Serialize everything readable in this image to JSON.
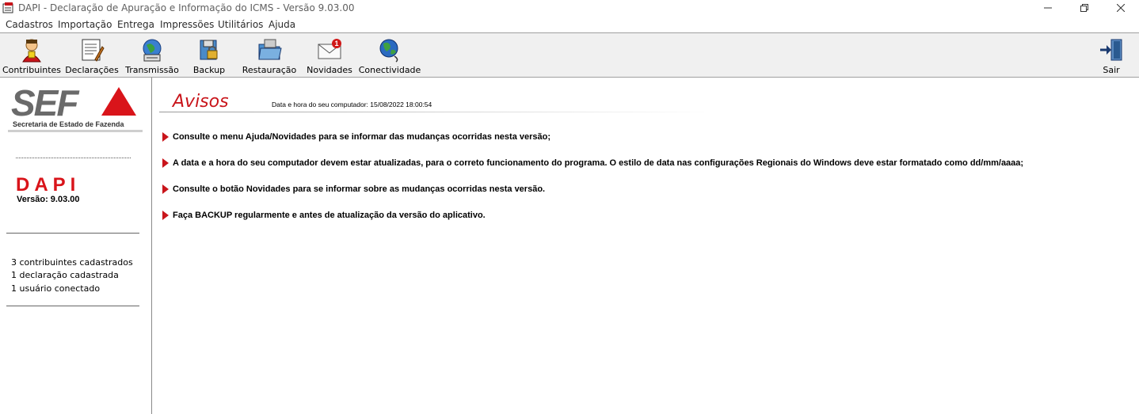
{
  "window": {
    "title": "DAPI - Declaração de Apuração e Informação do ICMS - Versão 9.03.00",
    "minimize": "—",
    "maximize": "❐",
    "close": "✕"
  },
  "menu": [
    "Cadastros",
    "Importação",
    "Entrega",
    "Impressões",
    "Utilitários",
    "Ajuda"
  ],
  "toolbar": {
    "items": [
      "Contribuintes",
      "Declarações",
      "Transmissão",
      "Backup",
      "Restauração",
      "Novidades",
      "Conectividade"
    ],
    "exit": "Sair",
    "novidades_badge": "1"
  },
  "sidebar": {
    "logo_text": "SEF",
    "logo_subtitle": "Secretaria de Estado de Fazenda",
    "app_name": "DAPI",
    "version": "Versão: 9.03.00",
    "stats": [
      "3 contribuintes cadastrados",
      "1 declaração cadastrada",
      "1 usuário conectado"
    ]
  },
  "main": {
    "title": "Avisos",
    "datetime": "Data e hora do seu computador: 15/08/2022 18:00:54",
    "notices": [
      "Consulte o menu Ajuda/Novidades para se informar das mudanças ocorridas nesta versão;",
      "A data e a hora do seu computador devem estar atualizadas, para o correto funcionamento do programa. O estilo de data nas configurações Regionais do Windows deve estar formatado como dd/mm/aaaa;",
      "Consulte o botão Novidades para se informar sobre as mudanças ocorridas nesta versão.",
      "Faça BACKUP regularmente e antes de atualização da versão do aplicativo."
    ]
  },
  "colors": {
    "accent_red": "#c9151b",
    "toolbar_bg": "#f0f0f0"
  }
}
